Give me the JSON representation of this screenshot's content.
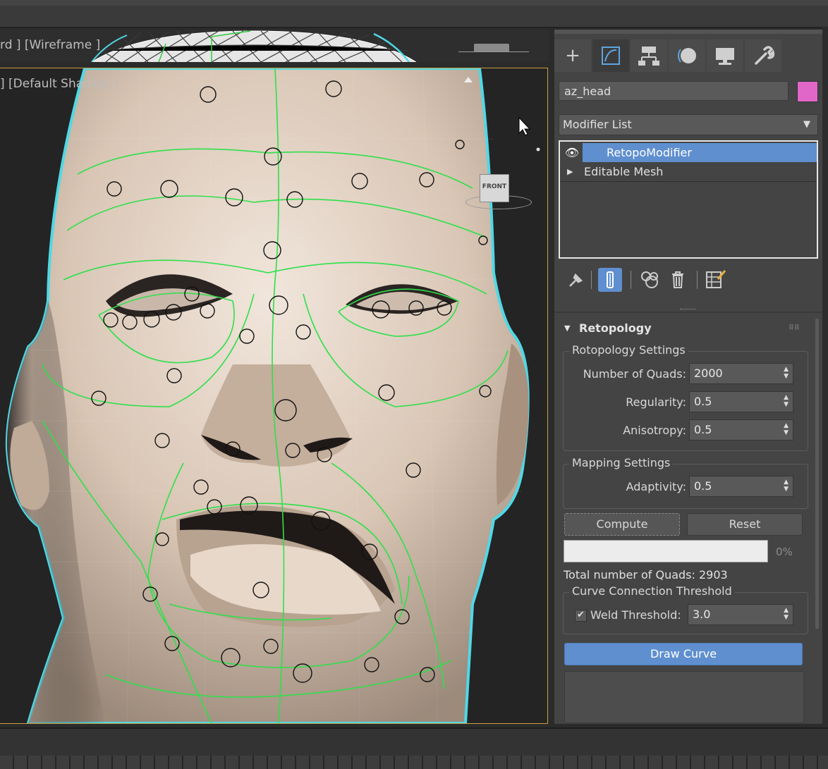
{
  "viewport_top": {
    "label": "rd ] [Wireframe ]"
  },
  "viewport_main": {
    "label": "] [Default Shading ]",
    "viewcube_label": "FRONT"
  },
  "command_panel": {
    "tabs": [
      {
        "name": "create",
        "icon": "+"
      },
      {
        "name": "modify",
        "icon": "modify-icon"
      },
      {
        "name": "hierarchy",
        "icon": "hierarchy-icon"
      },
      {
        "name": "motion",
        "icon": "motion-icon"
      },
      {
        "name": "display",
        "icon": "display-icon"
      },
      {
        "name": "utilities",
        "icon": "wrench-icon"
      }
    ],
    "object_name": "az_head",
    "object_color": "#e066c8",
    "modifier_list_label": "Modifier List",
    "stack": [
      {
        "label": "RetopoModifier",
        "selected": true
      },
      {
        "label": "Editable Mesh",
        "selected": false
      }
    ]
  },
  "retopology": {
    "title": "Retopology",
    "settings_group": "Rotopology Settings",
    "fields": {
      "quads_label": "Number of Quads:",
      "quads_value": "2000",
      "regularity_label": "Regularity:",
      "regularity_value": "0.5",
      "anisotropy_label": "Anisotropy:",
      "anisotropy_value": "0.5"
    },
    "mapping_group": "Mapping Settings",
    "adaptivity_label": "Adaptivity:",
    "adaptivity_value": "0.5",
    "compute_label": "Compute",
    "reset_label": "Reset",
    "progress_percent": "0%",
    "progress_value": 0,
    "total_quads_label": "Total number of Quads: 2903",
    "curve_group": "Curve Connection Threshold",
    "weld_label": "Weld Threshold:",
    "weld_checked": true,
    "weld_value": "3.0",
    "draw_curve_label": "Draw Curve"
  }
}
